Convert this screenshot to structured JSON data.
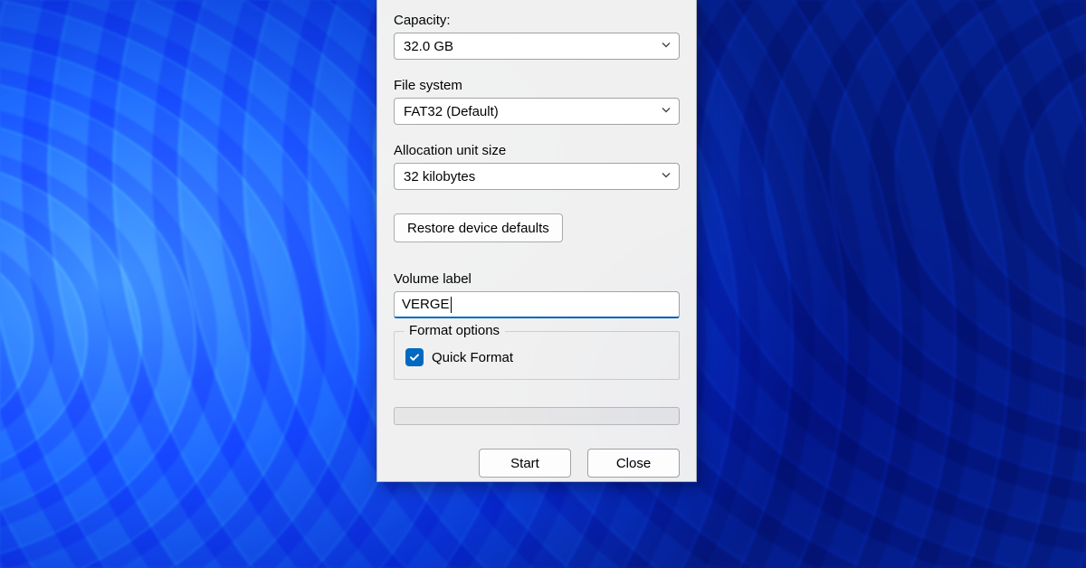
{
  "dialog": {
    "capacity_label": "Capacity:",
    "capacity_value": "32.0 GB",
    "filesystem_label": "File system",
    "filesystem_value": "FAT32 (Default)",
    "allocation_label": "Allocation unit size",
    "allocation_value": "32 kilobytes",
    "restore_btn": "Restore device defaults",
    "volume_label_caption": "Volume label",
    "volume_label_value": "VERGE",
    "format_options_legend": "Format options",
    "quick_format_label": "Quick Format",
    "quick_format_checked": true,
    "start_btn": "Start",
    "close_btn": "Close"
  },
  "colors": {
    "accent": "#0067c0"
  }
}
